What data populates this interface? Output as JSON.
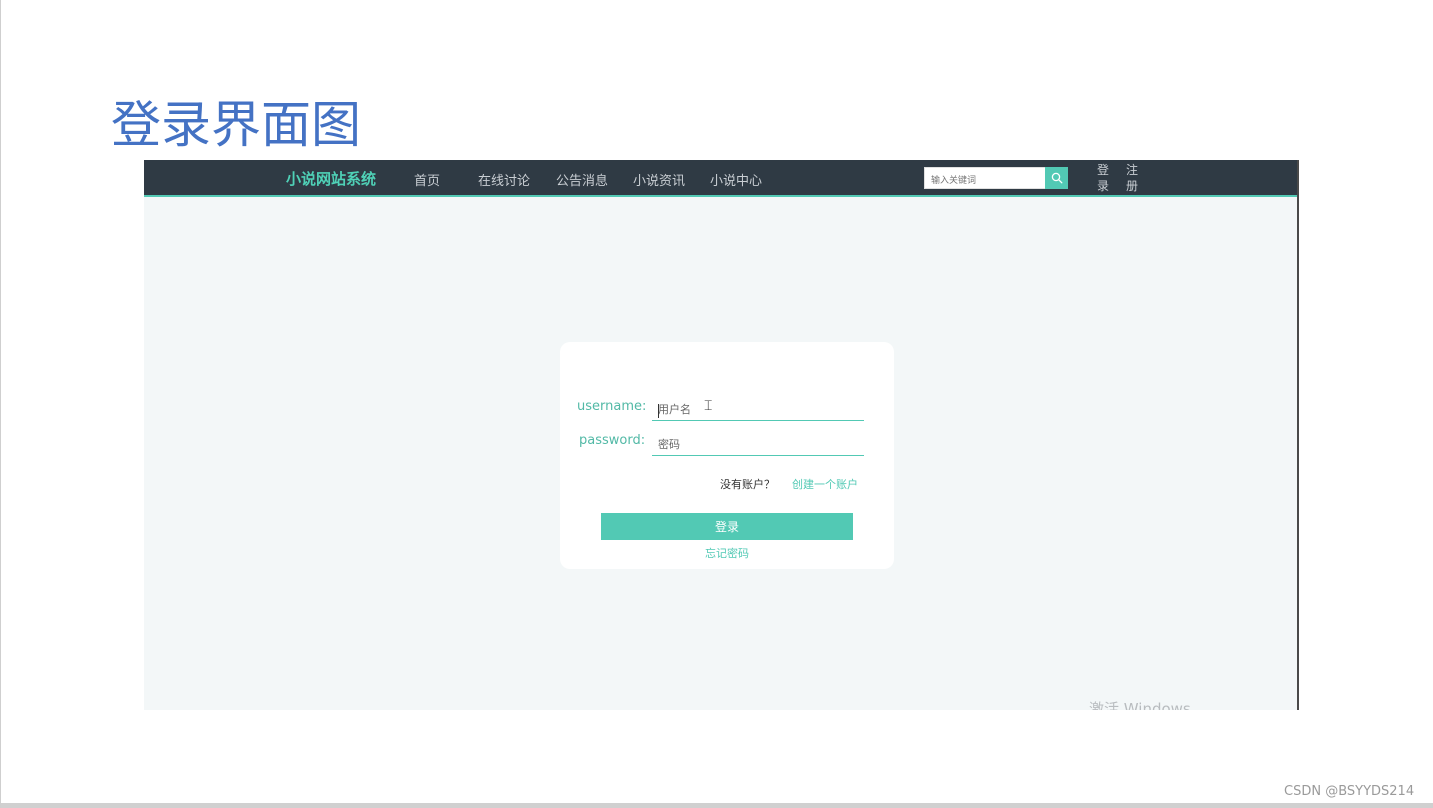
{
  "slide": {
    "title": "登录界面图",
    "credit": "CSDN @BSYYDS214"
  },
  "navbar": {
    "brand": "小说网站系统",
    "items": [
      {
        "label": "首页"
      },
      {
        "label": "在线讨论"
      },
      {
        "label": "公告消息"
      },
      {
        "label": "小说资讯"
      },
      {
        "label": "小说中心"
      }
    ],
    "search": {
      "placeholder": "输入关键词",
      "icon": "search-icon"
    },
    "login_label": "登录",
    "register_label": "注册"
  },
  "login_form": {
    "username_label": "username:",
    "username_placeholder": "用户名",
    "password_label": "password:",
    "password_placeholder": "密码",
    "no_account_text": "没有账户？",
    "create_account_link": "创建一个账户",
    "submit_label": "登录",
    "forgot_password_link": "忘记密码"
  },
  "watermark": "激活 Windows",
  "colors": {
    "accent": "#52c9b4",
    "navbar_bg": "#2f3a44",
    "title_blue": "#4472c4",
    "page_bg": "#f3f7f8"
  }
}
